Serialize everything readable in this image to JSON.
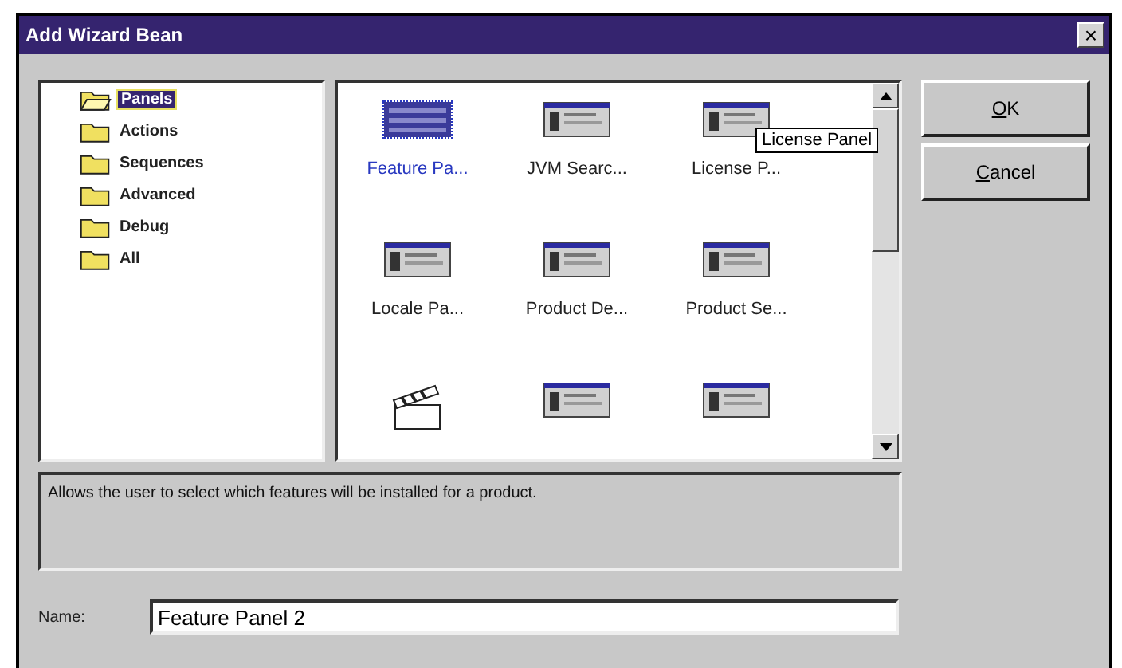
{
  "window": {
    "title": "Add Wizard Bean",
    "close": "×"
  },
  "tree": {
    "items": [
      {
        "label": "Panels",
        "selected": true
      },
      {
        "label": "Actions",
        "selected": false
      },
      {
        "label": "Sequences",
        "selected": false
      },
      {
        "label": "Advanced",
        "selected": false
      },
      {
        "label": "Debug",
        "selected": false
      },
      {
        "label": "All",
        "selected": false
      }
    ]
  },
  "beans": [
    {
      "kind": "feature",
      "label": "Feature Pa...",
      "selected": true
    },
    {
      "kind": "panel",
      "label": "JVM Searc...",
      "selected": false
    },
    {
      "kind": "panel",
      "label": "License P...",
      "selected": false
    },
    {
      "kind": "panel",
      "label": "Locale Pa...",
      "selected": false
    },
    {
      "kind": "panel",
      "label": "Product De...",
      "selected": false
    },
    {
      "kind": "panel",
      "label": "Product Se...",
      "selected": false
    },
    {
      "kind": "clapper",
      "selected": false
    },
    {
      "kind": "panel",
      "selected": false
    },
    {
      "kind": "panel",
      "selected": false
    }
  ],
  "tooltip": "License Panel",
  "buttons": [
    {
      "mnemonic": "O",
      "rest": "K"
    },
    {
      "mnemonic": "C",
      "rest": "ancel"
    }
  ],
  "description": "Allows the user to select which features will be installed for a product.",
  "name_field": {
    "label": "Name:",
    "value": "Feature Panel 2"
  }
}
